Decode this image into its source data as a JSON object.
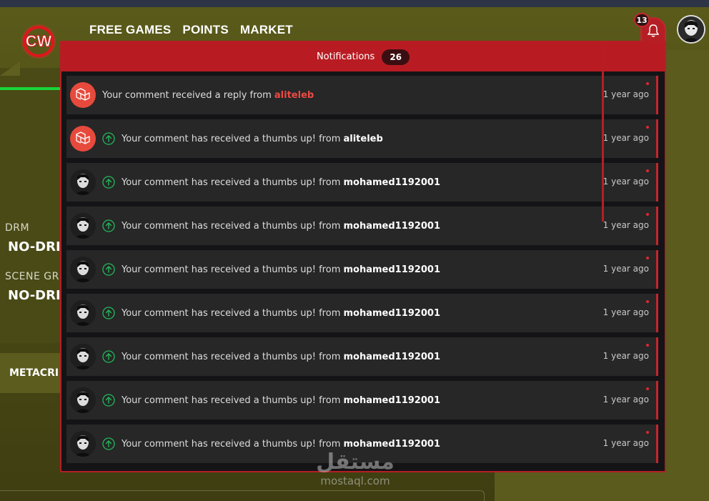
{
  "colors": {
    "accent": "#b81c22",
    "badge_dark": "#3b0f12",
    "link_red": "#ec4a44",
    "online_green": "#19d63a"
  },
  "nav": {
    "links": [
      "FREE GAMES",
      "POINTS",
      "MARKET"
    ]
  },
  "header": {
    "logo_text": "CW",
    "bell_count": "13"
  },
  "sidebar": {
    "drm_label": "DRM",
    "drm_value": "NO-DRI",
    "scene_label": "SCENE GR",
    "scene_value": "NO-DRI",
    "metacritic_label": "METACRI"
  },
  "notifications": {
    "title": "Notifications",
    "count": "26",
    "items": [
      {
        "icon": "laravel-avatar",
        "has_arrow": false,
        "text": "Your comment received a reply from ",
        "user": "aliteleb",
        "time": "1 year ago"
      },
      {
        "icon": "laravel-avatar",
        "has_arrow": true,
        "text": "Your comment has received a thumbs up! from ",
        "user": "aliteleb",
        "time": "1 year ago"
      },
      {
        "icon": "user-avatar",
        "has_arrow": true,
        "text": "Your comment has received a thumbs up! from ",
        "user": "mohamed1192001",
        "time": "1 year ago"
      },
      {
        "icon": "user-avatar",
        "has_arrow": true,
        "text": "Your comment has received a thumbs up! from ",
        "user": "mohamed1192001",
        "time": "1 year ago"
      },
      {
        "icon": "user-avatar",
        "has_arrow": true,
        "text": "Your comment has received a thumbs up! from ",
        "user": "mohamed1192001",
        "time": "1 year ago"
      },
      {
        "icon": "user-avatar",
        "has_arrow": true,
        "text": "Your comment has received a thumbs up! from ",
        "user": "mohamed1192001",
        "time": "1 year ago"
      },
      {
        "icon": "user-avatar",
        "has_arrow": true,
        "text": "Your comment has received a thumbs up! from ",
        "user": "mohamed1192001",
        "time": "1 year ago"
      },
      {
        "icon": "user-avatar",
        "has_arrow": true,
        "text": "Your comment has received a thumbs up! from ",
        "user": "mohamed1192001",
        "time": "1 year ago"
      },
      {
        "icon": "user-avatar",
        "has_arrow": true,
        "text": "Your comment has received a thumbs up! from ",
        "user": "mohamed1192001",
        "time": "1 year ago"
      }
    ]
  },
  "watermark": {
    "arabic": "مستقل",
    "latin": "mostaql.com"
  }
}
